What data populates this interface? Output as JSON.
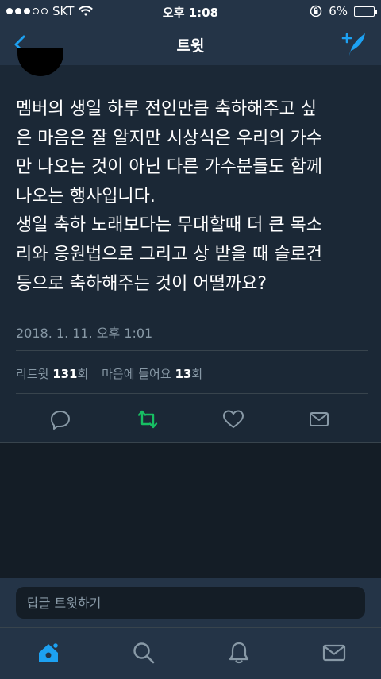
{
  "status_bar": {
    "carrier": "SKT",
    "time": "오후 1:08",
    "battery": "6%",
    "signal_bars": 3,
    "battery_level": 0.06
  },
  "nav": {
    "title": "트윗"
  },
  "author": {
    "handle_fragment": ""
  },
  "tweet": {
    "lines": [
      "멤버의 생일 하루 전인만큼 축하해주고 싶",
      "은 마음은 잘 알지만 시상식은 우리의 가수",
      "만 나오는 것이 아닌 다른 가수분들도 함께",
      "나오는 행사입니다.",
      "생일 축하 노래보다는 무대할때 더 큰 목소",
      "리와 응원법으로 그리고 상 받을 때 슬로건",
      "등으로 축하해주는 것이 어떨까요?"
    ],
    "timestamp": "2018. 1. 11. 오후 1:01"
  },
  "stats": {
    "retweet_label": "리트윗",
    "retweet_count": "131",
    "retweet_unit": "회",
    "like_label": "마음에 들어요",
    "like_count": "13",
    "like_unit": "회"
  },
  "actions": [
    "reply-icon",
    "retweet-icon",
    "heart-icon",
    "message-icon"
  ],
  "reply": {
    "placeholder": "답글 트윗하기"
  },
  "tabs": [
    "home-icon",
    "search-icon",
    "notifications-icon",
    "messages-icon"
  ],
  "colors": {
    "accent": "#1da1f2",
    "retweet_active": "#17bf63",
    "background": "#1b2836",
    "bar": "#243447"
  }
}
